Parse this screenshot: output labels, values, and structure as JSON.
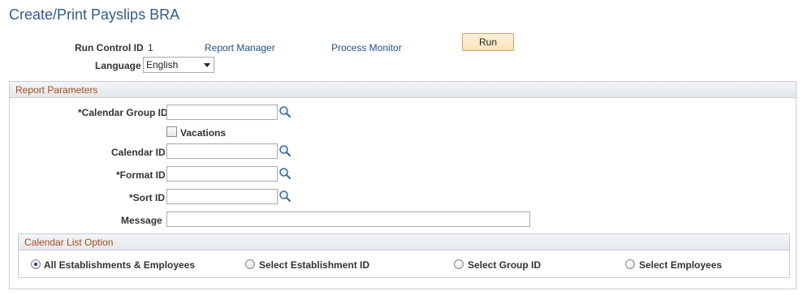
{
  "page": {
    "title": "Create/Print Payslips BRA"
  },
  "header": {
    "run_control_label": "Run Control ID",
    "run_control_value": "1",
    "report_manager_link": "Report Manager",
    "process_monitor_link": "Process Monitor",
    "run_button": "Run",
    "language_label": "Language",
    "language_value": "English"
  },
  "report_parameters": {
    "title": "Report Parameters",
    "calendar_group_label": "*Calendar Group ID",
    "calendar_group_value": "",
    "vacations_label": "Vacations",
    "vacations_checked": false,
    "calendar_id_label": "Calendar ID",
    "calendar_id_value": "",
    "format_id_label": "*Format ID",
    "format_id_value": "",
    "sort_id_label": "*Sort ID",
    "sort_id_value": "",
    "message_label": "Message",
    "message_value": ""
  },
  "calendar_list_option": {
    "title": "Calendar List Option",
    "options": [
      {
        "label": "All Establishments & Employees",
        "selected": true
      },
      {
        "label": "Select Establishment ID",
        "selected": false
      },
      {
        "label": "Select Group ID",
        "selected": false
      },
      {
        "label": "Select Employees",
        "selected": false
      }
    ]
  },
  "colors": {
    "title": "#2f5d8a",
    "link": "#1f4f88",
    "group_title": "#a84b1a",
    "run_button_bg": "#fbe3bb"
  },
  "icons": {
    "lookup": "magnifier-icon",
    "dropdown": "chevron-down-icon"
  }
}
